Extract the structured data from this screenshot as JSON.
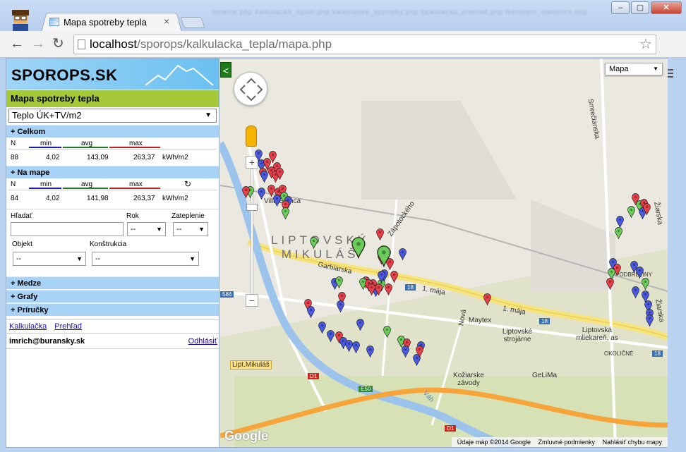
{
  "browser": {
    "tab_title": "Mapa spotreby tepla",
    "ghost_tabs": "                  ostatne.php   kalkulacka_opsat.php   kalkulacka_spotreby.php   kalkulacka_prehlad.php   Rensters_statistics.php",
    "url_host": "localhost",
    "url_path": "/sporops/kalkulacka_tepla/mapa.php",
    "back_icon": "back-arrow-icon",
    "forward_icon": "forward-arrow-icon",
    "reload_icon": "reload-icon",
    "bookmark_icon": "star-icon",
    "menu_icon": "hamburger-menu-icon"
  },
  "sidebar": {
    "logo": "SPOROPS.SK",
    "title": "Mapa spotreby tepla",
    "metric": "Teplo ÚK+TV/m2",
    "celkom": {
      "label": "+ Celkom",
      "headers": {
        "n": "N",
        "min": "min",
        "avg": "avg",
        "max": "max"
      },
      "values": {
        "n": "88",
        "min": "4,02",
        "avg": "143,09",
        "max": "263,37",
        "unit": "kWh/m2"
      }
    },
    "na_mape": {
      "label": "+ Na mape",
      "headers": {
        "n": "N",
        "min": "min",
        "avg": "avg",
        "max": "max"
      },
      "values": {
        "n": "84",
        "min": "4,02",
        "avg": "141,98",
        "max": "263,37",
        "unit": "kWh/m2"
      }
    },
    "form": {
      "search_label": "Hľadať",
      "search_value": "",
      "year_label": "Rok",
      "year_value": "--",
      "insulation_label": "Zateplenie",
      "insulation_value": "--",
      "object_label": "Objekt",
      "object_value": "--",
      "construction_label": "Konštrukcia",
      "construction_value": "--"
    },
    "sections": [
      "+ Medze",
      "+ Grafy",
      "+ Príručky"
    ],
    "links": [
      "Kalkulačka",
      "Prehľad"
    ],
    "user": "imrich@buransky.sk",
    "logout": "Odhlásiť"
  },
  "map": {
    "collapse_label": "<",
    "maptype": "Mapa",
    "city_line1": "LIPTOVSKÝ",
    "city_line2": "MIKULÁŠ",
    "labels": {
      "villa": "Villa Bianca",
      "garbiarska": "Garbiarska",
      "maja1": "1. mája",
      "maja2": "1. mája",
      "zapotockeho": "Zápotockého",
      "smrecianska": "Smrečianska",
      "ziarska1": "Žiarska",
      "ziarska2": "Žiarska",
      "podbreziny": "PODBREZINY",
      "okolicne": "OKOLIČNÉ",
      "nova": "Nová",
      "maytex": "Maytex",
      "strojarne": "Liptovské strojárne",
      "mliekaren": "Liptovská mliekareň, as",
      "kozarske": "Kožiarske závody",
      "gelima": "GeLiMa",
      "lipt_mikulas": "Lipt.Mikuláš",
      "vah": "Váh",
      "r584": "584",
      "r18a": "18",
      "r18b": "18",
      "r18c": "18",
      "d1a": "D1",
      "d1b": "D1",
      "e50": "E50"
    },
    "google": "Google",
    "footer": {
      "data": "Údaje máp ©2014 Google",
      "terms": "Zmluvné podmienky",
      "report": "Nahlásiť chybu mapy"
    },
    "pins": [
      [
        "blue",
        54,
        146
      ],
      [
        "red",
        74,
        148
      ],
      [
        "blue",
        58,
        160
      ],
      [
        "red",
        66,
        158
      ],
      [
        "red",
        80,
        164
      ],
      [
        "red",
        72,
        170
      ],
      [
        "red",
        60,
        172
      ],
      [
        "blue",
        62,
        176
      ],
      [
        "red",
        78,
        176
      ],
      [
        "red",
        84,
        172
      ],
      [
        "green",
        42,
        198
      ],
      [
        "red",
        36,
        198
      ],
      [
        "blue",
        58,
        200
      ],
      [
        "red",
        72,
        196
      ],
      [
        "red",
        82,
        200
      ],
      [
        "red",
        88,
        196
      ],
      [
        "green",
        90,
        206
      ],
      [
        "blue",
        96,
        212
      ],
      [
        "red",
        92,
        218
      ],
      [
        "blue",
        80,
        210
      ],
      [
        "green",
        92,
        228
      ],
      [
        "red",
        226,
        258
      ],
      [
        "green",
        132,
        270
      ],
      [
        "blue",
        258,
        286
      ],
      [
        "green",
        236,
        286
      ],
      [
        "red",
        228,
        292
      ],
      [
        "red",
        240,
        300
      ],
      [
        "blue",
        232,
        316
      ],
      [
        "green",
        228,
        330
      ],
      [
        "red",
        206,
        326
      ],
      [
        "red",
        216,
        330
      ],
      [
        "blue",
        220,
        338
      ],
      [
        "green",
        202,
        328
      ],
      [
        "red",
        210,
        330
      ],
      [
        "red",
        214,
        336
      ],
      [
        "red",
        224,
        336
      ],
      [
        "blue",
        228,
        318
      ],
      [
        "red",
        246,
        318
      ],
      [
        "red",
        238,
        336
      ],
      [
        "blue",
        162,
        328
      ],
      [
        "green",
        168,
        326
      ],
      [
        "red",
        172,
        348
      ],
      [
        "blue",
        170,
        360
      ],
      [
        "red",
        124,
        358
      ],
      [
        "blue",
        128,
        368
      ],
      [
        "blue",
        198,
        386
      ],
      [
        "red",
        378,
        350
      ],
      [
        "green",
        236,
        396
      ],
      [
        "blue",
        144,
        390
      ],
      [
        "blue",
        156,
        402
      ],
      [
        "red",
        168,
        404
      ],
      [
        "blue",
        174,
        412
      ],
      [
        "blue",
        182,
        416
      ],
      [
        "blue",
        192,
        418
      ],
      [
        "blue",
        212,
        424
      ],
      [
        "green",
        256,
        410
      ],
      [
        "red",
        264,
        414
      ],
      [
        "blue",
        262,
        424
      ],
      [
        "blue",
        284,
        418
      ],
      [
        "blue",
        278,
        436
      ],
      [
        "red",
        282,
        424
      ],
      [
        "red",
        588,
        208
      ],
      [
        "green",
        594,
        218
      ],
      [
        "red",
        600,
        216
      ],
      [
        "green",
        582,
        226
      ],
      [
        "blue",
        598,
        228
      ],
      [
        "red",
        604,
        222
      ],
      [
        "blue",
        566,
        240
      ],
      [
        "green",
        564,
        256
      ],
      [
        "blue",
        556,
        300
      ],
      [
        "red",
        562,
        308
      ],
      [
        "green",
        554,
        314
      ],
      [
        "blue",
        586,
        304
      ],
      [
        "blue",
        594,
        312
      ],
      [
        "green",
        602,
        328
      ],
      [
        "red",
        552,
        328
      ],
      [
        "blue",
        588,
        340
      ],
      [
        "blue",
        602,
        346
      ],
      [
        "blue",
        606,
        360
      ],
      [
        "blue",
        608,
        372
      ],
      [
        "blue",
        608,
        380
      ]
    ],
    "big_pins": [
      [
        "green",
        196,
        284
      ],
      [
        "green",
        232,
        296
      ]
    ]
  }
}
